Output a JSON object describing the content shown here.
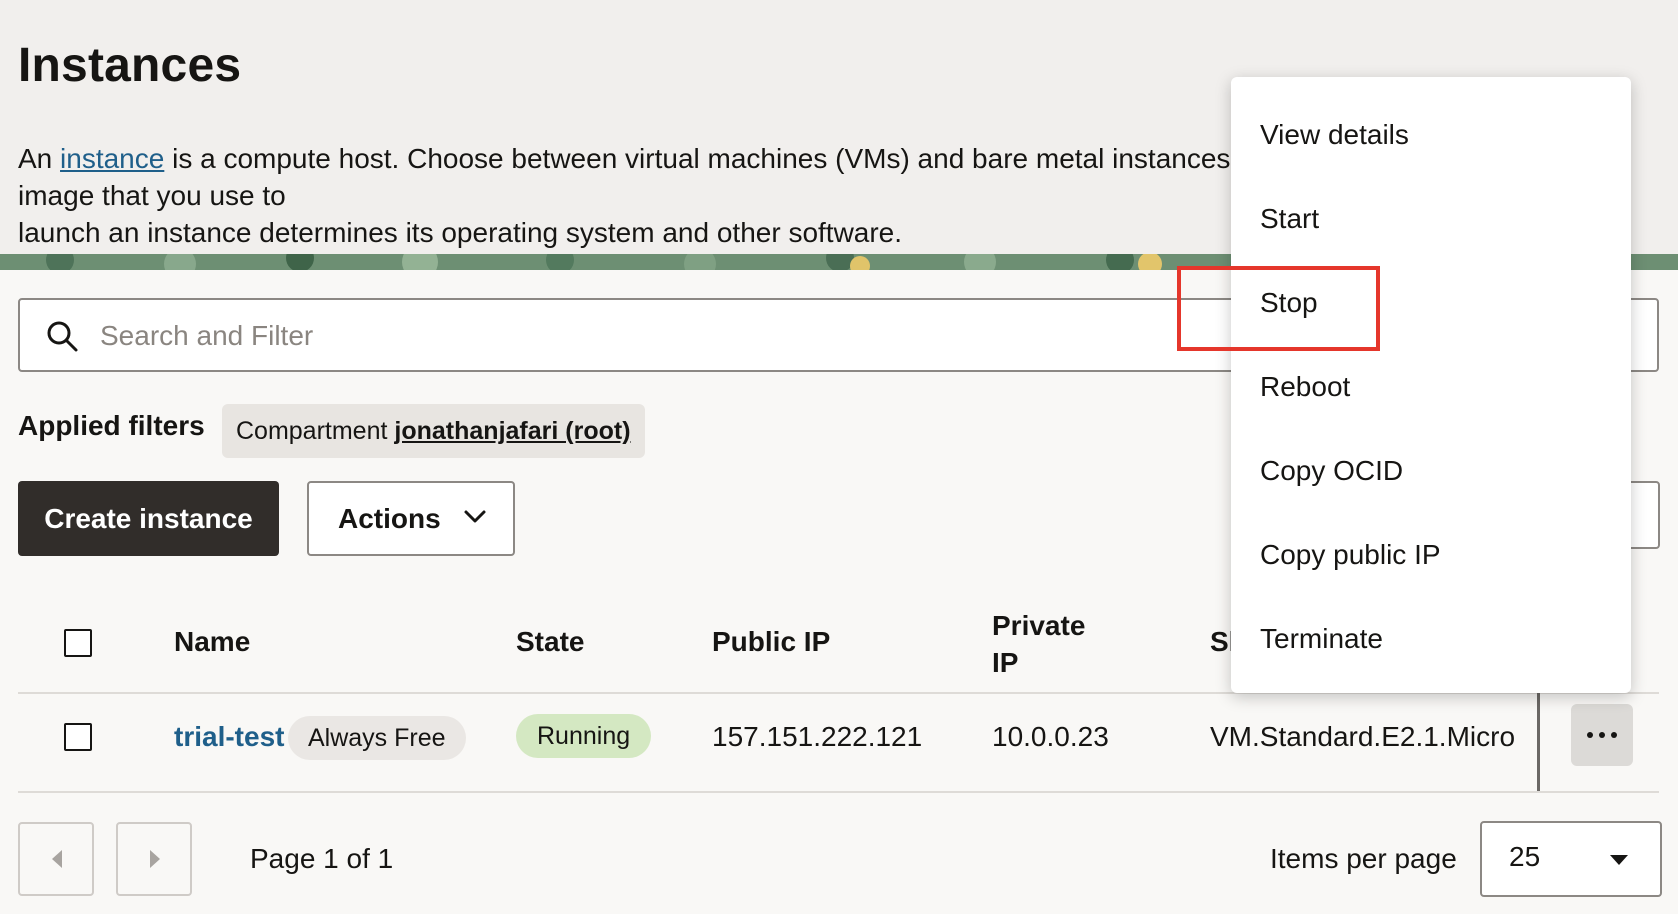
{
  "header": {
    "title": "Instances",
    "desc_prefix": "An ",
    "desc_link": "instance",
    "desc_line1_rest": " is a compute host. Choose between virtual machines (VMs) and bare metal instances. The image that you use to",
    "desc_line2": "launch an instance determines its operating system and other software."
  },
  "search": {
    "placeholder": "Search and Filter",
    "value": ""
  },
  "filters": {
    "label": "Applied filters",
    "chip_key": "Compartment",
    "chip_value": "jonathanjafari (root)"
  },
  "toolbar": {
    "create_label": "Create instance",
    "actions_label": "Actions"
  },
  "table": {
    "columns": [
      "Name",
      "State",
      "Public IP",
      "Private IP",
      "Shape"
    ],
    "private_ip_header_line1": "Private",
    "private_ip_header_line2": "IP",
    "shape_header_visible": "Sh",
    "rows": [
      {
        "name": "trial-test",
        "tag": "Always Free",
        "state": "Running",
        "public_ip": "157.151.222.121",
        "private_ip": "10.0.0.23",
        "shape": "VM.Standard.E2.1.Micro"
      }
    ]
  },
  "pagination": {
    "page_info": "Page 1 of 1",
    "items_per_page_label": "Items per page",
    "items_per_page_value": "25"
  },
  "context_menu": {
    "items": [
      "View details",
      "Start",
      "Stop",
      "Reboot",
      "Copy OCID",
      "Copy public IP",
      "Terminate"
    ],
    "highlighted_item": "Stop"
  },
  "colors": {
    "link": "#1f5f8a",
    "primary_button": "#312d2a",
    "running_badge": "#d4e8c2",
    "highlight_box": "#e5362b"
  }
}
